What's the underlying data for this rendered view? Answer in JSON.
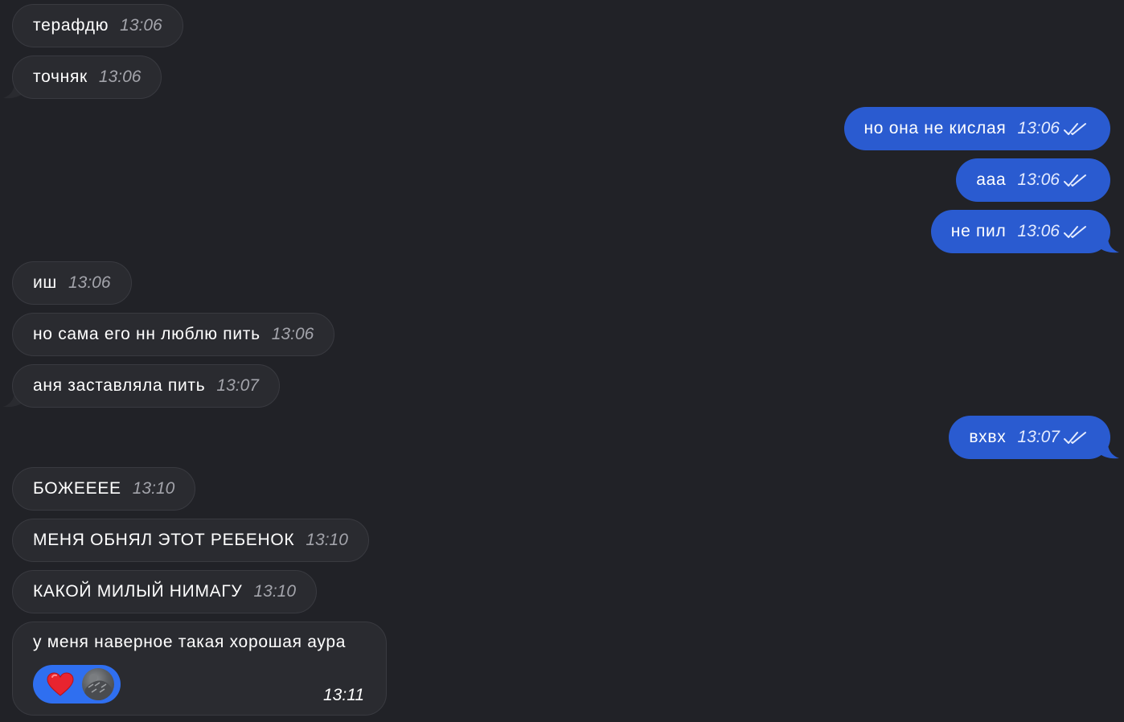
{
  "messages": [
    {
      "dir": "in",
      "text": "терафдю",
      "time": "13:06"
    },
    {
      "dir": "in",
      "text": "точняк",
      "time": "13:06"
    },
    {
      "dir": "out",
      "text": "но она не кислая",
      "time": "13:06"
    },
    {
      "dir": "out",
      "text": "ааа",
      "time": "13:06"
    },
    {
      "dir": "out",
      "text": "не пил",
      "time": "13:06"
    },
    {
      "dir": "in",
      "text": "иш",
      "time": "13:06"
    },
    {
      "dir": "in",
      "text": "но сама его нн люблю пить",
      "time": "13:06"
    },
    {
      "dir": "in",
      "text": "аня заставляла пить",
      "time": "13:07"
    },
    {
      "dir": "out",
      "text": "вхвх",
      "time": "13:07"
    },
    {
      "dir": "in",
      "text": "БОЖЕЕЕЕ",
      "time": "13:10"
    },
    {
      "dir": "in",
      "text": "МЕНЯ ОБНЯЛ ЭТОТ РЕБЕНОК",
      "time": "13:10"
    },
    {
      "dir": "in",
      "text": "КАКОЙ МИЛЫЙ НИМАГУ",
      "time": "13:10"
    },
    {
      "dir": "in",
      "text": "у меня наверное такая хорошая аура",
      "time": "13:11",
      "reaction": {
        "icon": "heart-icon",
        "avatar": "user-avatar"
      }
    }
  ],
  "colors": {
    "background": "#212227",
    "incoming_bubble": "#2a2b30",
    "outgoing_bubble": "#2a5bd0",
    "reaction_pill": "#2f6ff0",
    "heart": "#e8242f"
  }
}
